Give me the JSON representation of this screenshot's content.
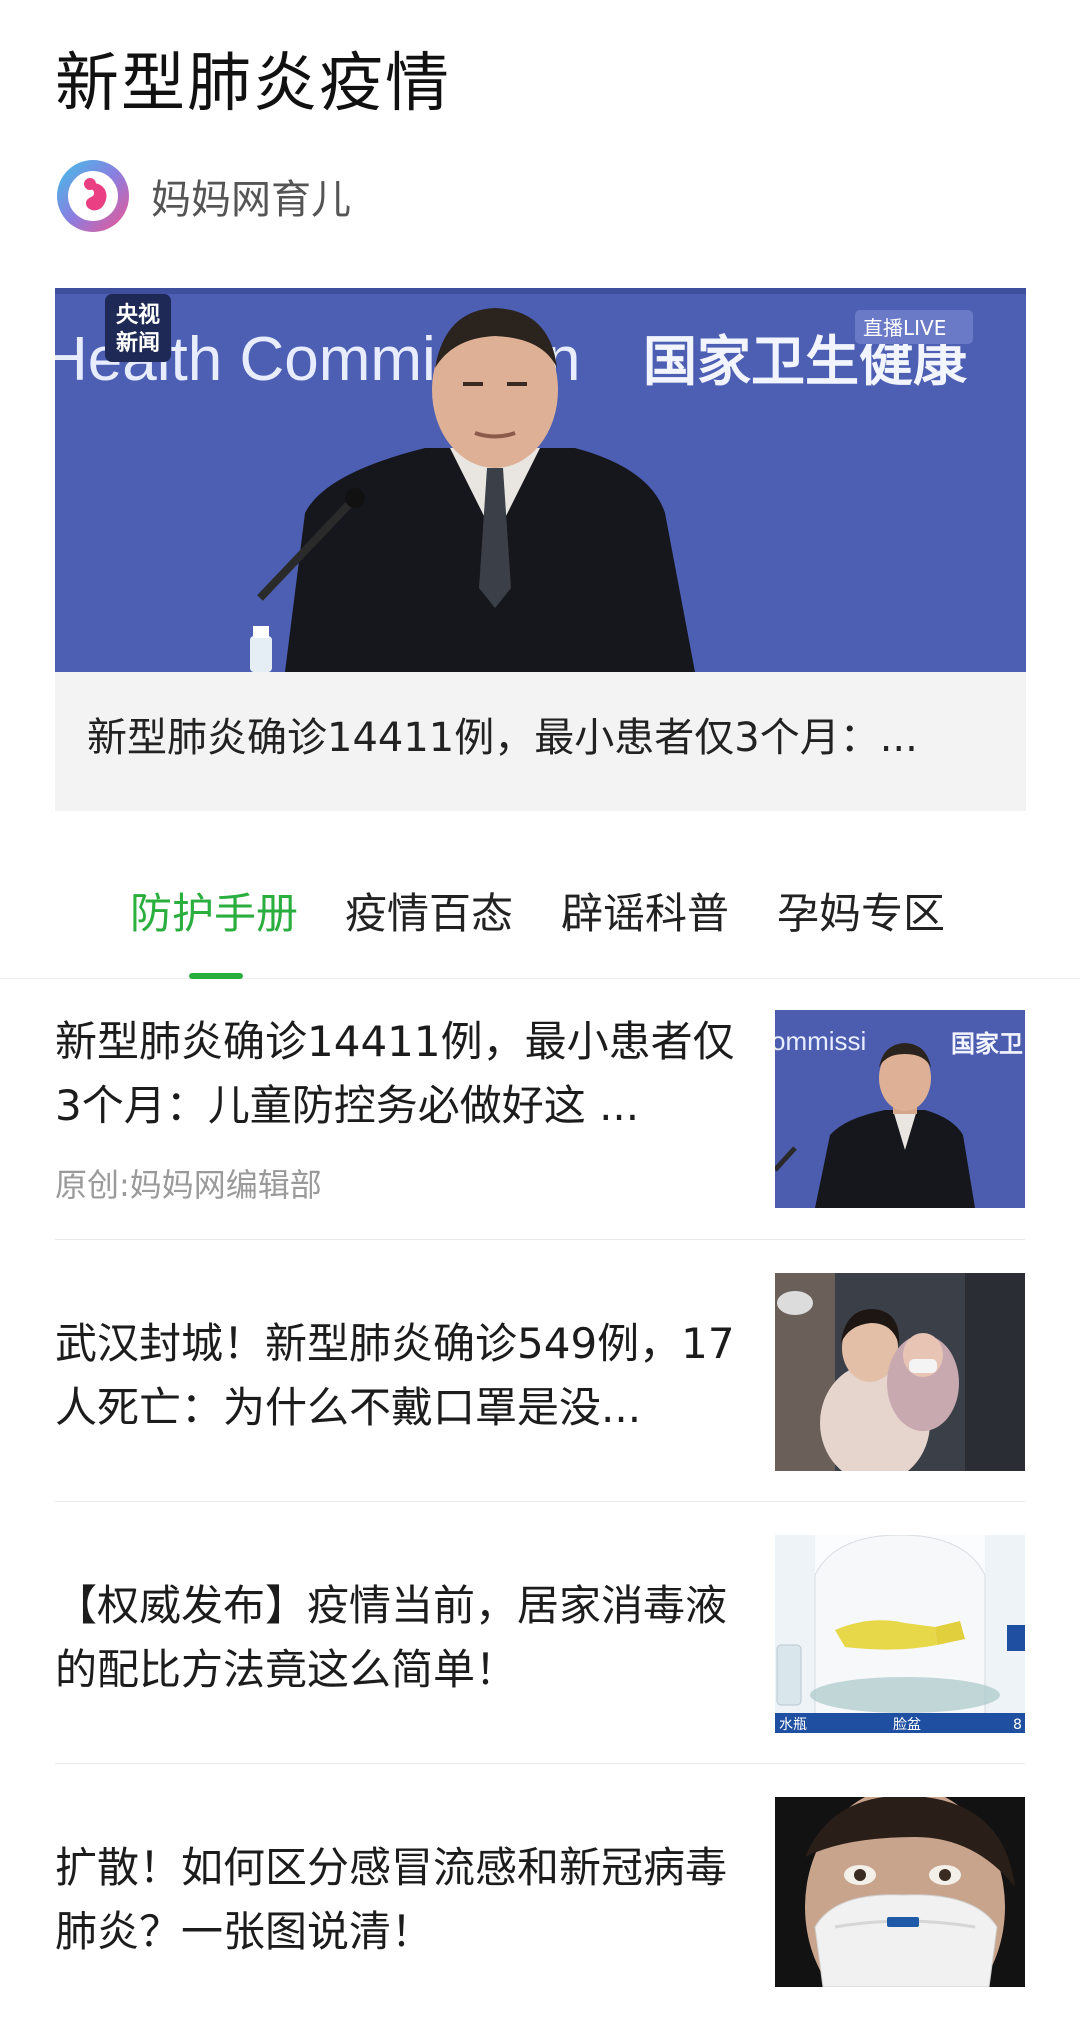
{
  "page": {
    "title": "新型肺炎疫情"
  },
  "publisher": {
    "name": "妈妈网育儿",
    "logo_icon": "baby-logo-icon"
  },
  "hero": {
    "image_texts": {
      "badge_line1": "央视",
      "badge_line2": "新闻",
      "backdrop_left": "Health Commission",
      "backdrop_right": "国家卫生健康",
      "live_badge": "直播LIVE"
    },
    "caption": "新型肺炎确诊14411例，最小患者仅3个月：..."
  },
  "tabs": [
    {
      "label": "防护手册",
      "active": true
    },
    {
      "label": "疫情百态",
      "active": false
    },
    {
      "label": "辟谣科普",
      "active": false
    },
    {
      "label": "孕妈专区",
      "active": false
    }
  ],
  "articles": [
    {
      "title": "新型肺炎确诊14411例，最小患者仅3个月：儿童防控务必做好这 ...",
      "source": "原创:妈妈网编辑部",
      "thumb_texts": {
        "left": "ommissi",
        "right": "国家卫"
      }
    },
    {
      "title": "武汉封城！新型肺炎确诊549例，17人死亡：为什么不戴口罩是没...",
      "source": ""
    },
    {
      "title": "【权威发布】疫情当前，居家消毒液的配比方法竟这么简单！",
      "source": "",
      "thumb_texts": {
        "label_1": "水瓶",
        "label_2": "脸盆",
        "label_3": "8"
      }
    },
    {
      "title": "扩散！如何区分感冒流感和新冠病毒肺炎？一张图说清！",
      "source": ""
    }
  ],
  "colors": {
    "accent": "#2aae3e",
    "hero_bg": "#4d5fb3",
    "caption_bg": "#f3f3f3"
  }
}
